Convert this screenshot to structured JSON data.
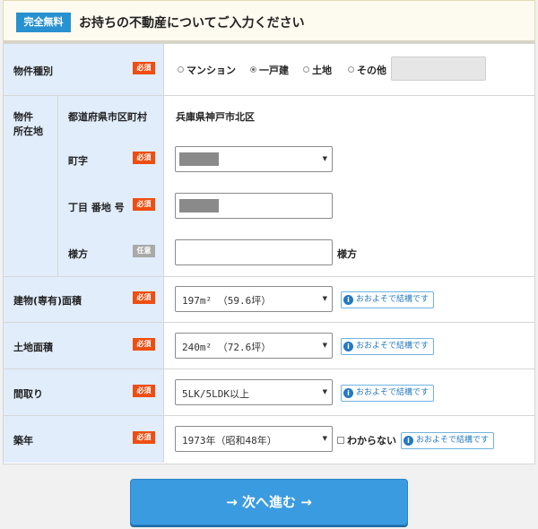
{
  "header": {
    "badge": "完全無料",
    "title": "お持ちの不動産についてご入力ください"
  },
  "badges": {
    "required": "必須",
    "optional": "任意"
  },
  "rows": {
    "property_type": {
      "label": "物件種別",
      "options": [
        {
          "label": "マンション",
          "selected": false
        },
        {
          "label": "一戸建",
          "selected": true
        },
        {
          "label": "土地",
          "selected": false
        },
        {
          "label": "その他",
          "selected": false
        }
      ]
    },
    "location": {
      "label_line1": "物件",
      "label_line2": "所在地",
      "prefecture": {
        "label": "都道府県市区町村",
        "value": "兵庫県神戸市北区"
      },
      "town": {
        "label": "町字"
      },
      "chome": {
        "label": "丁目 番地 号"
      },
      "sama": {
        "label": "様方",
        "suffix": "様方"
      }
    },
    "building_area": {
      "label": "建物(専有)面積",
      "value": "197m² （59.6坪）"
    },
    "land_area": {
      "label": "土地面積",
      "value": "240m² （72.6坪）"
    },
    "layout": {
      "label": "間取り",
      "value": "5LK/5LDK以上"
    },
    "age": {
      "label": "築年",
      "value": "1973年（昭和48年）",
      "unknown_label": "わからない"
    }
  },
  "tip": {
    "icon": "i",
    "label": "おおよそで結構です"
  },
  "next_button": {
    "label": "→ 次へ進む →"
  }
}
